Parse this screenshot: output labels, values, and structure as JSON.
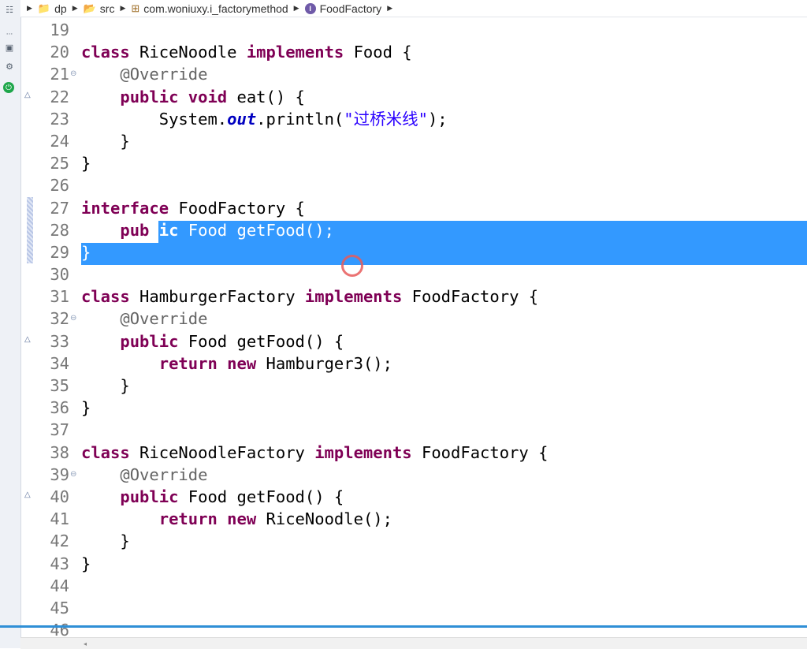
{
  "breadcrumb": {
    "items": [
      {
        "label": "dp",
        "icon": "project-icon"
      },
      {
        "label": "src",
        "icon": "source-folder-icon"
      },
      {
        "label": "com.woniuxy.i_factorymethod",
        "icon": "package-icon"
      },
      {
        "label": "FoodFactory",
        "icon": "interface-icon"
      }
    ]
  },
  "editor": {
    "lines": [
      {
        "n": "19",
        "text": ""
      },
      {
        "n": "20",
        "text": "class RiceNoodle implements Food {"
      },
      {
        "n": "21",
        "text": "    @Override"
      },
      {
        "n": "22",
        "text": "    public void eat() {"
      },
      {
        "n": "23",
        "text": "        System.out.println(\"过桥米线\");"
      },
      {
        "n": "24",
        "text": "    }"
      },
      {
        "n": "25",
        "text": "}"
      },
      {
        "n": "26",
        "text": ""
      },
      {
        "n": "27",
        "text": "interface FoodFactory {"
      },
      {
        "n": "28",
        "text": "    public Food getFood();"
      },
      {
        "n": "29",
        "text": "}"
      },
      {
        "n": "30",
        "text": ""
      },
      {
        "n": "31",
        "text": "class HamburgerFactory implements FoodFactory {"
      },
      {
        "n": "32",
        "text": "    @Override"
      },
      {
        "n": "33",
        "text": "    public Food getFood() {"
      },
      {
        "n": "34",
        "text": "        return new Hamburger3();"
      },
      {
        "n": "35",
        "text": "    }"
      },
      {
        "n": "36",
        "text": "}"
      },
      {
        "n": "37",
        "text": ""
      },
      {
        "n": "38",
        "text": "class RiceNoodleFactory implements FoodFactory {"
      },
      {
        "n": "39",
        "text": "    @Override"
      },
      {
        "n": "40",
        "text": "    public Food getFood() {"
      },
      {
        "n": "41",
        "text": "        return new RiceNoodle();"
      },
      {
        "n": "42",
        "text": "    }"
      },
      {
        "n": "43",
        "text": "}"
      },
      {
        "n": "44",
        "text": ""
      },
      {
        "n": "45",
        "text": ""
      },
      {
        "n": "46",
        "text": ""
      }
    ]
  },
  "colors": {
    "keyword": "#7f0055",
    "annotation": "#646464",
    "string": "#2a00ff",
    "static_field": "#0000c0",
    "selection": "#3399ff"
  }
}
